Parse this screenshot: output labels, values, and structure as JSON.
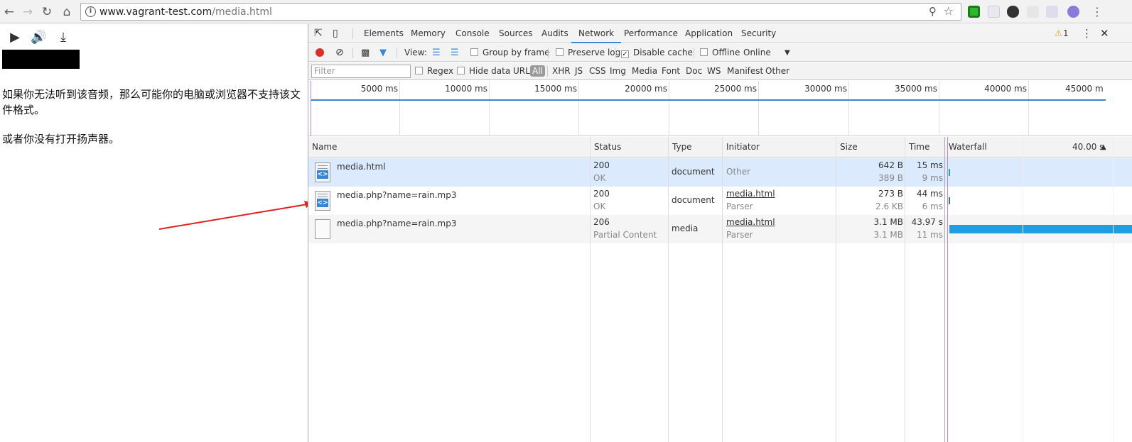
{
  "browser": {
    "url_host": "www.vagrant-test.com",
    "url_path": "/media.html",
    "back_icon": "arrow-left",
    "forward_icon": "arrow-right",
    "reload_icon": "reload",
    "home_icon": "home",
    "zoom_icon": "magnifier",
    "bookmark_icon": "star",
    "info_glyph": "i"
  },
  "page": {
    "message_1": "如果你无法听到该音频，那么可能你的电脑或浏览器不支持该文件格式。",
    "message_2": "或者你没有打开扬声器。"
  },
  "devtools": {
    "tabs": [
      "Elements",
      "Memory",
      "Console",
      "Sources",
      "Audits",
      "Network",
      "Performance",
      "Application",
      "Security"
    ],
    "active_tab": "Network",
    "warning_count": "1",
    "toolbar": {
      "view_label": "View:",
      "group_by_frame": "Group by frame",
      "preserve_log": "Preserve log",
      "disable_cache": "Disable cache",
      "offline": "Offline",
      "throttle": "Online"
    },
    "filter": {
      "placeholder": "Filter",
      "regex": "Regex",
      "hide_data_urls": "Hide data URLs",
      "types": [
        "All",
        "XHR",
        "JS",
        "CSS",
        "Img",
        "Media",
        "Font",
        "Doc",
        "WS",
        "Manifest",
        "Other"
      ]
    },
    "overview_ticks": [
      "5000 ms",
      "10000 ms",
      "15000 ms",
      "20000 ms",
      "25000 ms",
      "30000 ms",
      "35000 ms",
      "40000 ms",
      "45000 m"
    ],
    "columns": {
      "name": "Name",
      "status": "Status",
      "type": "Type",
      "initiator": "Initiator",
      "size": "Size",
      "time": "Time",
      "waterfall": "Waterfall",
      "waterfall_time": "40.00 s"
    },
    "rows": [
      {
        "name": "media.html",
        "status": "200",
        "status_text": "OK",
        "type": "document",
        "initiator": "Other",
        "initiator_sub": "",
        "size": "642 B",
        "size_sub": "389 B",
        "time": "15 ms",
        "time_sub": "9 ms"
      },
      {
        "name": "media.php?name=rain.mp3",
        "status": "200",
        "status_text": "OK",
        "type": "document",
        "initiator": "media.html",
        "initiator_sub": "Parser",
        "size": "273 B",
        "size_sub": "2.6 KB",
        "time": "44 ms",
        "time_sub": "6 ms"
      },
      {
        "name": "media.php?name=rain.mp3",
        "status": "206",
        "status_text": "Partial Content",
        "type": "media",
        "initiator": "media.html",
        "initiator_sub": "Parser",
        "size": "3.1 MB",
        "size_sub": "3.1 MB",
        "time": "43.97 s",
        "time_sub": "11 ms"
      }
    ]
  },
  "colors": {
    "accent_blue": "#3b85d6",
    "waterfall_bar": "#1f9ee6",
    "record_red": "#d9302c",
    "annotation_arrow": "#e02020",
    "selected_row": "#dbeafc"
  }
}
